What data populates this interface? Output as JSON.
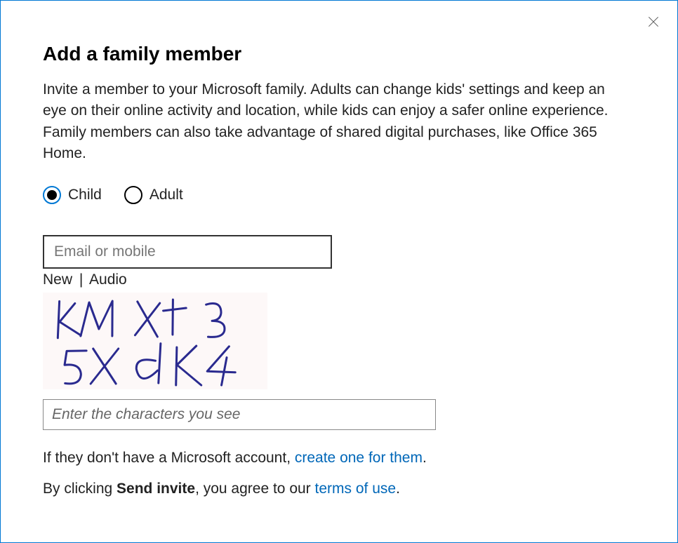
{
  "title": "Add a family member",
  "description": "Invite a member to your Microsoft family. Adults can change kids' settings and keep an eye on their online activity and location, while kids can enjoy a safer online experience. Family members can also take advantage of shared digital purchases, like Office 365 Home.",
  "radio": {
    "child_label": "Child",
    "adult_label": "Adult",
    "selected": "child"
  },
  "email_placeholder": "Email or mobile",
  "captcha": {
    "new_label": "New",
    "separator": "|",
    "audio_label": "Audio",
    "text": "kMXt3 5XdK4",
    "input_placeholder": "Enter the characters you see"
  },
  "create_account": {
    "prefix": "If they don't have a Microsoft account, ",
    "link": "create one for them",
    "suffix": "."
  },
  "terms": {
    "prefix": "By clicking ",
    "bold": "Send invite",
    "mid": ", you agree to our ",
    "link": "terms of use",
    "suffix": "."
  }
}
